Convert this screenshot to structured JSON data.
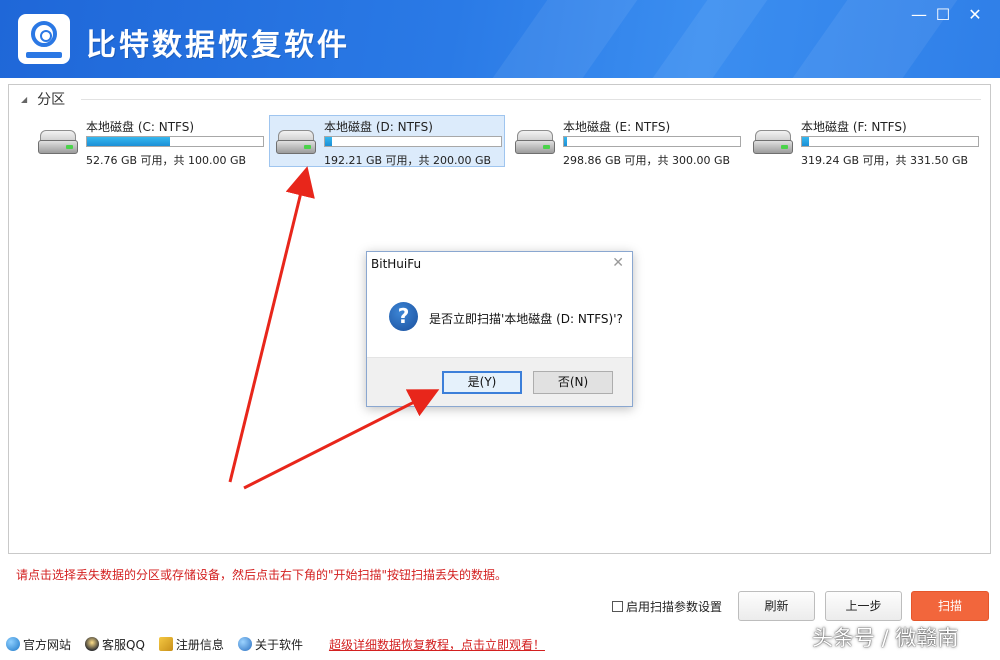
{
  "titlebar": {
    "title": "比特数据恢复软件",
    "minimize": "—",
    "maximize": "☐",
    "close": "✕"
  },
  "partition_section": {
    "label": "分区"
  },
  "drives": [
    {
      "name": "本地磁盘 (C: NTFS)",
      "info": "52.76 GB 可用，共 100.00 GB",
      "used_fraction": 0.47
    },
    {
      "name": "本地磁盘 (D: NTFS)",
      "info": "192.21 GB 可用，共 200.00 GB",
      "used_fraction": 0.04
    },
    {
      "name": "本地磁盘 (E: NTFS)",
      "info": "298.86 GB 可用，共 300.00 GB",
      "used_fraction": 0.004
    },
    {
      "name": "本地磁盘 (F: NTFS)",
      "info": "319.24 GB 可用，共 331.50 GB",
      "used_fraction": 0.037
    }
  ],
  "hint": "请点击选择丢失数据的分区或存储设备，然后点击右下角的\"开始扫描\"按钮扫描丢失的数据。",
  "controls": {
    "scan_params_label": "启用扫描参数设置",
    "refresh": "刷新",
    "prev": "上一步",
    "scan": "扫描"
  },
  "footer": {
    "website": "官方网站",
    "qq": "客服QQ",
    "register": "注册信息",
    "about": "关于软件",
    "tutorial_link": "超级详细数据恢复教程，点击立即观看！"
  },
  "watermark": "头条号 / 微赣南",
  "dialog": {
    "title": "BitHuiFu",
    "close": "✕",
    "message": "是否立即扫描'本地磁盘 (D: NTFS)'?",
    "icon": "?",
    "yes": "是(Y)",
    "no": "否(N)"
  },
  "colors": {
    "accent": "#2a7ae6",
    "scan_button": "#f2663c",
    "hint": "#d32020",
    "annotation_arrow": "#e8261b"
  }
}
